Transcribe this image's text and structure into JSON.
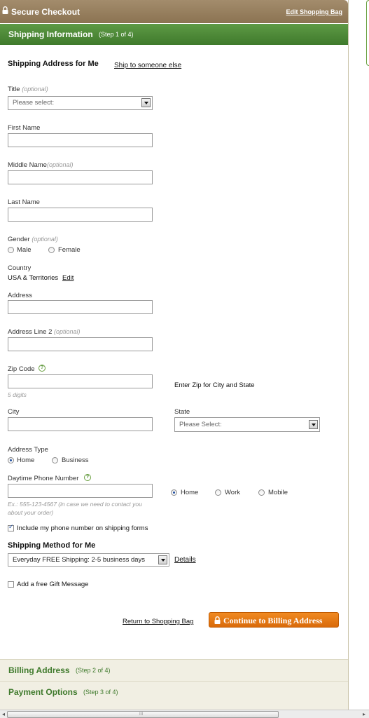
{
  "header": {
    "title": "Secure Checkout",
    "edit_bag": "Edit Shopping Bag"
  },
  "step1": {
    "title": "Shipping Information",
    "step": "(Step 1 of 4)"
  },
  "address": {
    "heading": "Shipping Address for Me",
    "ship_other": "Ship to someone else",
    "title_label": "Title",
    "title_optional": "(optional)",
    "title_select": "Please select:",
    "first_name": "First Name",
    "middle_name": "Middle Name",
    "middle_optional": "(optional)",
    "last_name": "Last Name",
    "gender": "Gender",
    "gender_optional": "(optional)",
    "male": "Male",
    "female": "Female",
    "country_label": "Country",
    "country_value": "USA & Territories",
    "country_edit": "Edit",
    "address_label": "Address",
    "address2_label": "Address Line 2",
    "address2_optional": "(optional)",
    "zip_label": "Zip Code",
    "zip_hint": "5 digits",
    "zip_note": "Enter Zip for City and State",
    "city_label": "City",
    "state_label": "State",
    "state_select": "Please Select:",
    "address_type": "Address Type",
    "type_home": "Home",
    "type_business": "Business",
    "phone_label": "Daytime Phone Number",
    "phone_hint": "Ex.: 555-123-4567 (in case we need to contact you about your order)",
    "phone_home": "Home",
    "phone_work": "Work",
    "phone_mobile": "Mobile",
    "include_phone": "Include my phone number on shipping forms"
  },
  "shipping_method": {
    "heading": "Shipping Method for Me",
    "selected": "Everyday FREE Shipping: 2-5 business days",
    "details": "Details",
    "gift": "Add a free Gift Message"
  },
  "actions": {
    "return": "Return to Shopping Bag",
    "continue": "Continue to Billing Address"
  },
  "step2": {
    "title": "Billing Address",
    "step": "(Step 2 of 4)"
  },
  "step3": {
    "title": "Payment Options",
    "step": "(Step 3 of 4)"
  },
  "scrollbar": {
    "grip": "III"
  }
}
